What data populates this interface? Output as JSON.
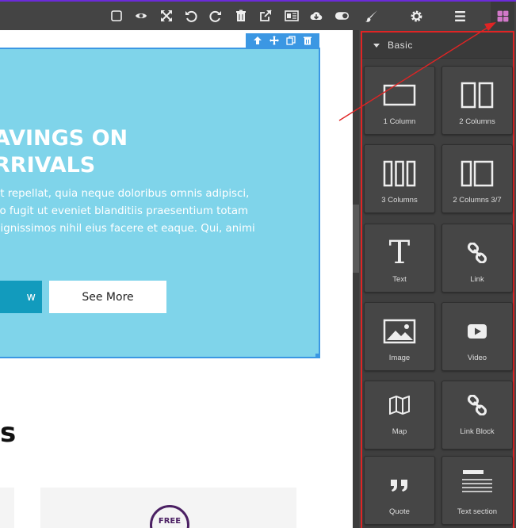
{
  "colors": {
    "toolbar_bg": "#444444",
    "accent_purple": "#d278c9",
    "selection_blue": "#3b97e3",
    "hero_bg": "#7fd4ea",
    "primary_button": "#129bbd",
    "highlight_red": "#e02424"
  },
  "toolbar": {
    "icons": [
      "square-outline-icon",
      "eye-icon",
      "fullscreen-icon",
      "undo-icon",
      "redo-icon",
      "trash-icon",
      "external-link-icon",
      "code-icon",
      "download-cloud-icon",
      "toggle-icon"
    ],
    "panel_icons": [
      "paint-brush-icon",
      "gear-icon",
      "hamburger-icon",
      "blocks-grid-icon"
    ],
    "active_panel": "blocks-grid-icon"
  },
  "hero": {
    "title_line1": "AVINGS ON",
    "title_line2": "RRIVALS",
    "body_line1": "at repellat, quia neque doloribus omnis adipisci,",
    "body_line2": "lio fugit ut eveniet blanditiis praesentium totam",
    "body_line3": "dignissimos nihil eius facere et eaque. Qui, animi",
    "primary_button_label": "w",
    "secondary_button_label": "See More"
  },
  "selection_toolbar": {
    "icons": [
      "arrow-up-icon",
      "move-icon",
      "copy-icon",
      "trash-icon"
    ]
  },
  "section": {
    "heading": "s"
  },
  "card": {
    "badge_text": "FREE"
  },
  "blocks_panel": {
    "category": "Basic",
    "blocks": [
      {
        "label": "1 Column",
        "icon": "one-column-icon"
      },
      {
        "label": "2 Columns",
        "icon": "two-columns-icon"
      },
      {
        "label": "3 Columns",
        "icon": "three-columns-icon"
      },
      {
        "label": "2 Columns 3/7",
        "icon": "two-columns-3-7-icon"
      },
      {
        "label": "Text",
        "icon": "text-icon"
      },
      {
        "label": "Link",
        "icon": "link-icon"
      },
      {
        "label": "Image",
        "icon": "image-icon"
      },
      {
        "label": "Video",
        "icon": "video-icon"
      },
      {
        "label": "Map",
        "icon": "map-icon"
      },
      {
        "label": "Link Block",
        "icon": "link-block-icon"
      },
      {
        "label": "Quote",
        "icon": "quote-icon"
      },
      {
        "label": "Text section",
        "icon": "text-section-icon"
      }
    ]
  }
}
